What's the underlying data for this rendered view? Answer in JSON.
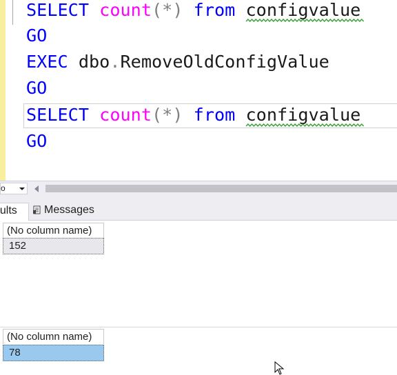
{
  "editor": {
    "lines": [
      {
        "tokens": [
          {
            "text": "SELECT",
            "kind": "keyword"
          },
          {
            "text": " ",
            "kind": "text"
          },
          {
            "text": "count",
            "kind": "function"
          },
          {
            "text": "(*)",
            "kind": "operator"
          },
          {
            "text": " ",
            "kind": "text"
          },
          {
            "text": "from",
            "kind": "keyword"
          },
          {
            "text": " ",
            "kind": "text"
          },
          {
            "text": "configvalue",
            "kind": "squiggle"
          }
        ]
      },
      {
        "tokens": [
          {
            "text": "GO",
            "kind": "keyword"
          }
        ]
      },
      {
        "tokens": [
          {
            "text": "EXEC",
            "kind": "keyword"
          },
          {
            "text": " dbo",
            "kind": "text"
          },
          {
            "text": ".",
            "kind": "operator"
          },
          {
            "text": "RemoveOldConfigValue",
            "kind": "text"
          }
        ]
      },
      {
        "tokens": [
          {
            "text": "GO",
            "kind": "keyword"
          }
        ]
      },
      {
        "tokens": [
          {
            "text": "SELECT",
            "kind": "keyword"
          },
          {
            "text": " ",
            "kind": "text"
          },
          {
            "text": "count",
            "kind": "function"
          },
          {
            "text": "(*)",
            "kind": "operator"
          },
          {
            "text": " ",
            "kind": "text"
          },
          {
            "text": "from",
            "kind": "keyword"
          },
          {
            "text": " ",
            "kind": "text"
          },
          {
            "text": "configvalue",
            "kind": "squiggle"
          }
        ]
      },
      {
        "tokens": [
          {
            "text": "GO",
            "kind": "keyword"
          }
        ]
      }
    ],
    "colors": {
      "keyword": "#0000ff",
      "function": "#ff00ff",
      "operator": "#808080",
      "squiggle": "#2e9e2e",
      "gutter": "#f7ef9e"
    }
  },
  "zoom": {
    "value": "o"
  },
  "tabs": {
    "results_label": "esults",
    "messages_label": "Messages"
  },
  "grids": [
    {
      "column_header": "(No column name)",
      "value": "152",
      "selected": false
    },
    {
      "column_header": "(No column name)",
      "value": "78",
      "selected": true
    }
  ]
}
